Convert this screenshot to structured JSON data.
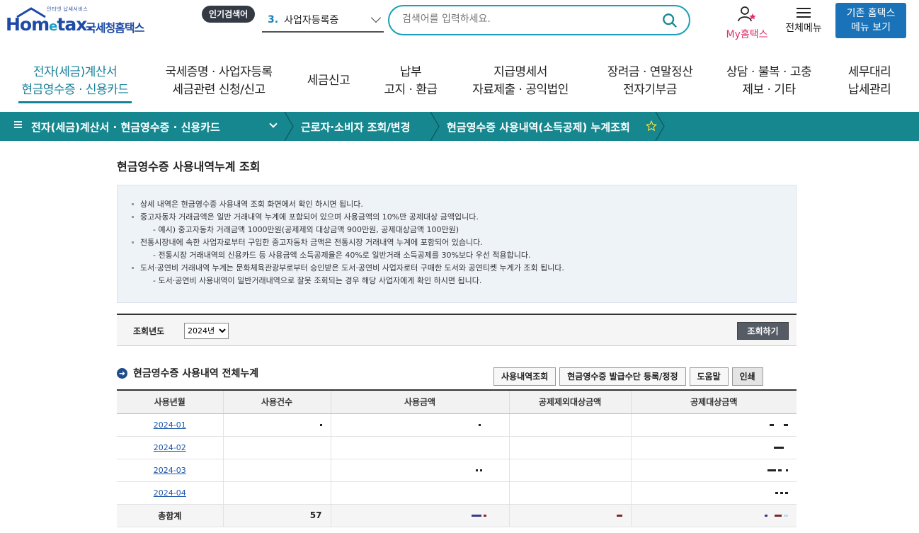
{
  "header": {
    "logo_tiny": "인터넷 납세서비스",
    "logo_word_a": "Hom",
    "logo_word_e": "e",
    "logo_word_b": "tax.",
    "logo_kr": "국세청홈택스",
    "popular_badge": "인기검색어",
    "popular_rank": "3.",
    "popular_term": "사업자등록증",
    "search_placeholder": "검색어를 입력하세요.",
    "my_hometax": "My홈택스",
    "all_menu": "전체메뉴",
    "old_hometax_1": "기존 홈택스",
    "old_hometax_2": "메뉴 보기"
  },
  "gnb": [
    {
      "l1": "전자(세금)계산서",
      "l2": "현금영수증 · 신용카드"
    },
    {
      "l1": "국세증명 · 사업자등록",
      "l2": "세금관련 신청/신고"
    },
    {
      "l1": "세금신고",
      "l2": ""
    },
    {
      "l1": "납부",
      "l2": "고지 · 환급"
    },
    {
      "l1": "지급명세서",
      "l2": "자료제출 · 공익법인"
    },
    {
      "l1": "장려금 · 연말정산",
      "l2": "전자기부금"
    },
    {
      "l1": "상담 · 불복 · 고충",
      "l2": "제보 · 기타"
    },
    {
      "l1": "세무대리",
      "l2": "납세관리"
    }
  ],
  "location": {
    "level1": "전자(세금)계산서 · 현금영수증 · 신용카드",
    "level2": "근로자·소비자 조회/변경",
    "level3": "현금영수증 사용내역(소득공제) 누계조회"
  },
  "page": {
    "title": "현금영수증 사용내역누계 조회",
    "notices": [
      {
        "type": "b",
        "text": "상세 내역은 현금영수증 사용내역 조회 화면에서 확인 하시면 됩니다."
      },
      {
        "type": "b",
        "text": "중고자동차 거래금액은 일반 거래내역 누계에 포함되어 있으며 사용금액의 10%만 공제대상 금액입니다."
      },
      {
        "type": "sub",
        "text": "- 예시) 중고자동차 거래금액 1000만원(공제제외 대상금액 900만원, 공제대상금액 100만원)"
      },
      {
        "type": "b",
        "text": "전통시장내에 속한 사업자로부터 구입한 중고자동차 금액은 전통시장 거래내역 누계에 포함되어 있습니다."
      },
      {
        "type": "sub",
        "text": "- 전통시장 거래내역의 신용카드 등 사용금액 소득공제율은 40%로 일반거래 소득공제를 30%보다 우선 적용합니다."
      },
      {
        "type": "b",
        "text": "도서·공연비 거래내역 누계는 문화체육관광부로부터 승인받은 도서·공연비 사업자로터 구매한 도서와 공연티켓 누계가 조회 됩니다."
      },
      {
        "type": "sub",
        "text": "- 도서·공연비 사용내역이 일반거래내역으로 잘못 조회되는 경우 해당 사업자에게 확인 하시면 됩니다."
      }
    ],
    "filter_label": "조회년도",
    "year_selected": "2024년",
    "query_button": "조회하기",
    "section_title": "현금영수증 사용내역 전체누계",
    "buttons": [
      "사용내역조회",
      "현금영수증 발급수단 등록/정정",
      "도움말",
      "인쇄"
    ]
  },
  "table": {
    "headers": [
      "사용년월",
      "사용건수",
      "사용금액",
      "공제제외대상금액",
      "공제대상금액"
    ],
    "rows": [
      {
        "month": "2024-01"
      },
      {
        "month": "2024-02"
      },
      {
        "month": "2024-03"
      },
      {
        "month": "2024-04"
      }
    ],
    "total_label": "총합계",
    "total_count": "57"
  },
  "colors": {
    "teal": "#17878f",
    "accent": "#17819a",
    "blue": "#1a73b8",
    "pink": "#e0306a"
  }
}
